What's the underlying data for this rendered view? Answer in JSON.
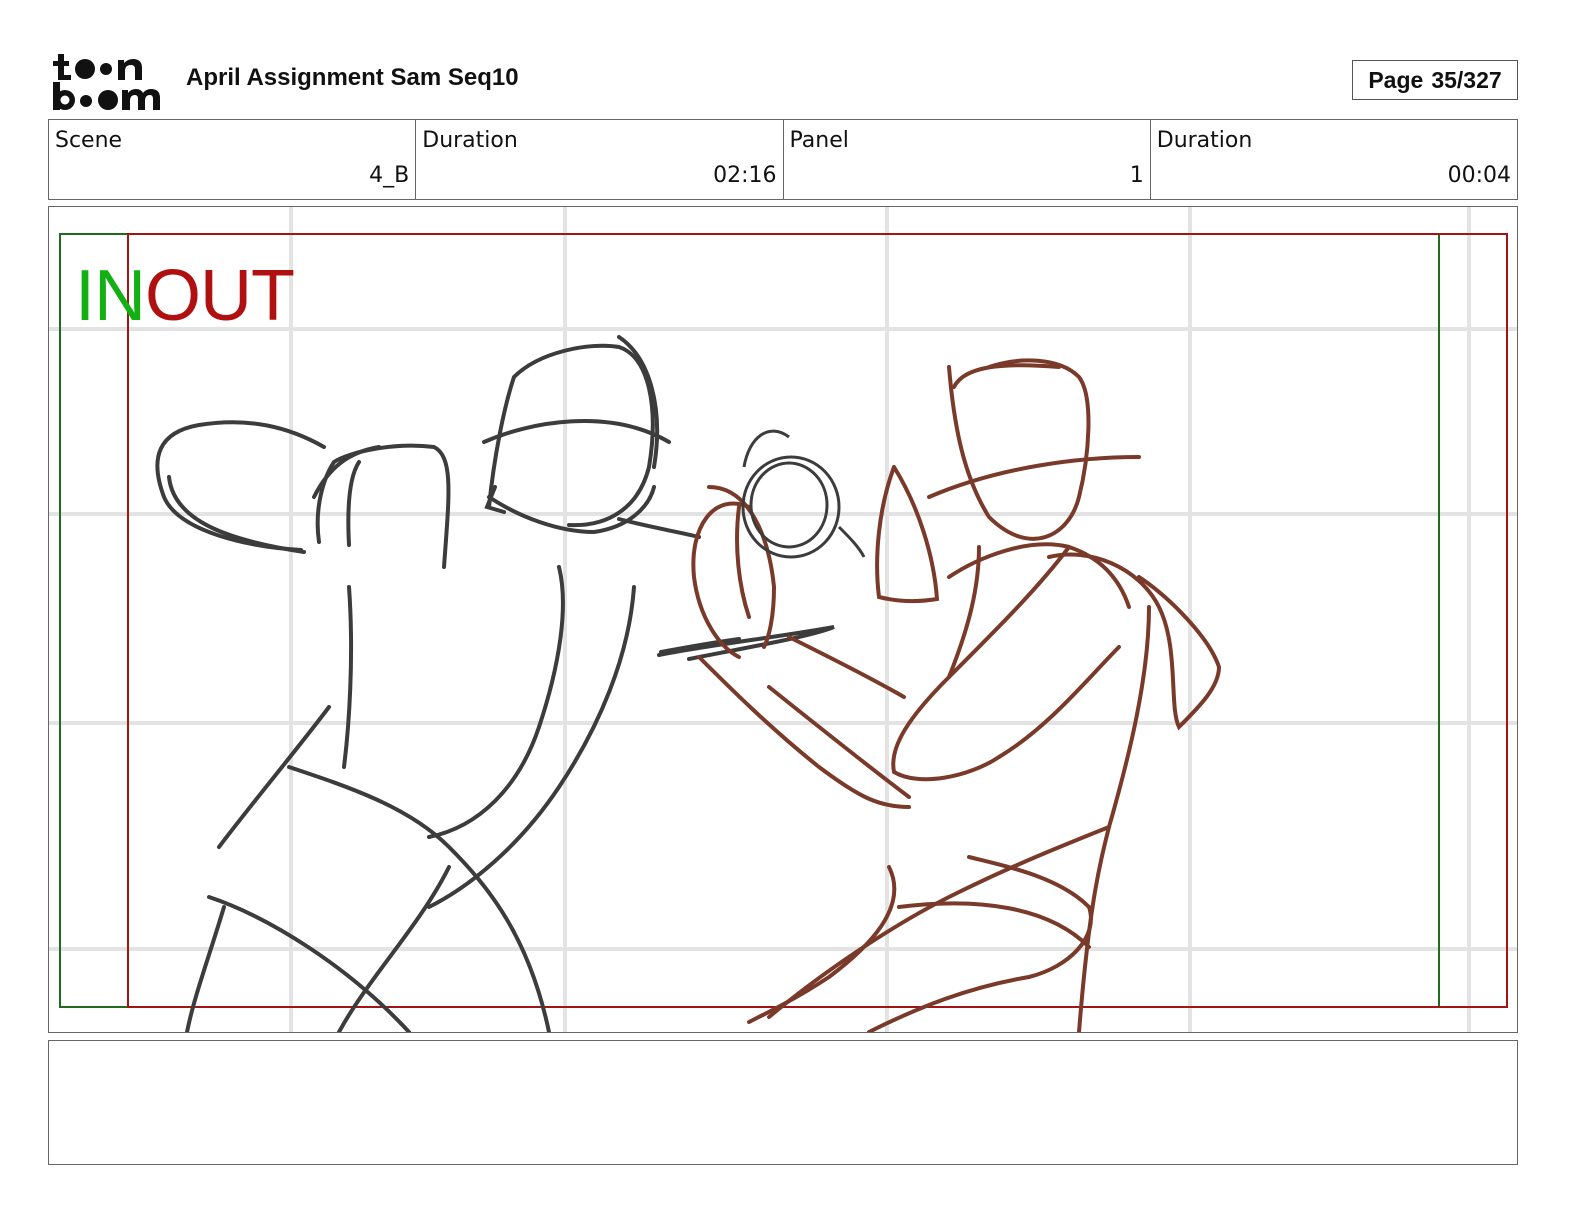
{
  "header": {
    "logo_text": "toon boom",
    "title": "April Assignment Sam Seq10",
    "page_label": "Page",
    "page_value": "35/327"
  },
  "info": {
    "scene_label": "Scene",
    "scene_value": "4_B",
    "scene_duration_label": "Duration",
    "scene_duration_value": "02:16",
    "panel_label": "Panel",
    "panel_value": "1",
    "panel_duration_label": "Duration",
    "panel_duration_value": "00:04"
  },
  "panel": {
    "in_label": "IN",
    "out_label": "OUT",
    "colors": {
      "in_green": "#12b012",
      "out_red": "#b01010",
      "sketch_grey": "#3c3c3c",
      "sketch_brown": "#7a3a2a",
      "grid": "#e3e3e3"
    }
  },
  "notes": {
    "text": ""
  }
}
